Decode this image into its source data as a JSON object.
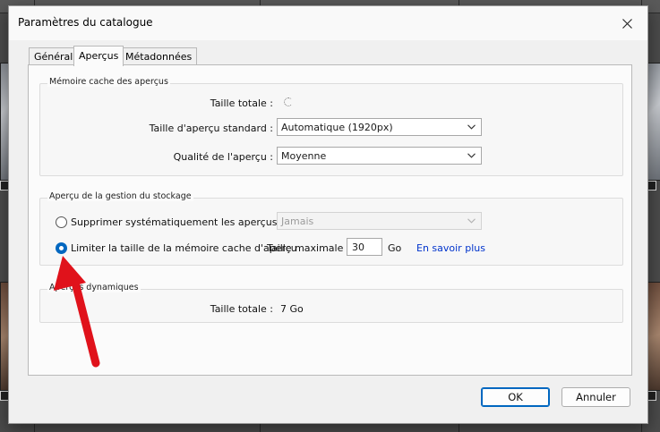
{
  "dialog": {
    "title": "Paramètres du catalogue",
    "tabs": [
      "Général",
      "Aperçus",
      "Métadonnées"
    ],
    "active_tab": "Aperçus"
  },
  "cache": {
    "group_label": "Mémoire cache des aperçus",
    "total_size_label": "Taille totale :",
    "standard_size_label": "Taille d'aperçu standard :",
    "standard_size_value": "Automatique (1920px)",
    "quality_label": "Qualité de l'aperçu :",
    "quality_value": "Moyenne"
  },
  "storage": {
    "group_label": "Aperçu de la gestion du stockage",
    "delete_option_label": "Supprimer systématiquement les aperçus 1:1 :",
    "delete_option_value": "Jamais",
    "limit_option_label": "Limiter la taille de la mémoire cache d'aperçu",
    "max_size_label": "Taille maximale :",
    "max_size_value": "30",
    "unit": "Go",
    "learn_more": "En savoir plus",
    "selected_option": "limit"
  },
  "dynamic": {
    "group_label": "Aperçus dynamiques",
    "total_size_label": "Taille totale :",
    "total_size_value": "7 Go"
  },
  "buttons": {
    "ok": "OK",
    "cancel": "Annuler"
  },
  "colors": {
    "accent": "#0067c0",
    "link": "#0033cc",
    "arrow": "#e0121b"
  }
}
